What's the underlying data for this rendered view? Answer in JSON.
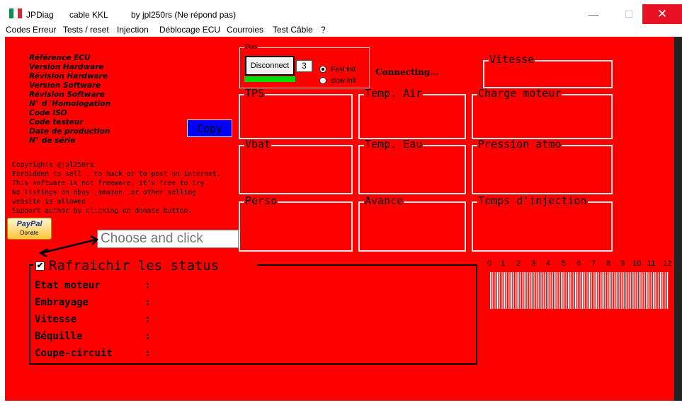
{
  "window": {
    "app_name": "JPDiag",
    "cable": "cable KKL",
    "author": "by jpl250rs (Ne répond pas)",
    "minimize_glyph": "—",
    "maximize_glyph": "☐",
    "close_glyph": "✕",
    "flag_colors": [
      "#009246",
      "#ffffff",
      "#ce2b37"
    ]
  },
  "menu": [
    "Codes Erreur",
    "Tests / reset",
    "Injection",
    "Déblocage ECU",
    "Courroies",
    "Test Câble",
    "?"
  ],
  "ecu_labels": [
    "Référence ECU",
    "Version Hardware",
    "Révision Hardware",
    "Version Software",
    "Révision Software",
    "N° d 'Homologation",
    "Code ISO",
    "Code testeur",
    "Date de production",
    "N° de série"
  ],
  "copy_button": "Copy",
  "info_text": [
    "Copyrights @jpl250rs",
    "Forbidden to sell , to hack or to post on internet.",
    "This software is not freeware, it's free to try.",
    "No listings on ebay ,amazon ,or other selling",
    "website is allowed .",
    "Support author by clicking on donate button."
  ],
  "paypal": {
    "brand": "PayPal",
    "label": "Donate"
  },
  "choose_input": {
    "placeholder": "Choose and click"
  },
  "port": {
    "title": "Port",
    "disconnect_button": "Disconnect",
    "port_number": "3",
    "fast_init": "Fast init",
    "slow_init": "slow init",
    "selected": "fast"
  },
  "connection_status": "Connecting...",
  "gauges": {
    "vitesse": "Vitesse",
    "tps": "TPS",
    "temp_air": "Temp. Air",
    "charge_moteur": "Charge moteur",
    "vbat": "Vbat",
    "temp_eau": "Temp. Eau",
    "pression_atmo": "Pression atmo",
    "perso": "Perso",
    "avance": "Avance",
    "temps_injection": "Temps d'injection"
  },
  "status_group": {
    "checkbox_label": "Rafraichir les status",
    "checked": true,
    "rows": [
      {
        "label": "Etat moteur",
        "sep": ":"
      },
      {
        "label": "Embrayage",
        "sep": ":"
      },
      {
        "label": "Vitesse",
        "sep": ":"
      },
      {
        "label": "Béquille",
        "sep": ":"
      },
      {
        "label": "Coupe-circuit",
        "sep": ":"
      }
    ]
  },
  "scale": [
    "0",
    "1",
    "2",
    "3",
    "4",
    "5",
    "6",
    "7",
    "8",
    "9",
    "10",
    "11",
    "12"
  ],
  "colors": {
    "background": "#ff0000",
    "copy_button": "#0000ff",
    "progress": "#00dd00",
    "close": "#e81123"
  }
}
